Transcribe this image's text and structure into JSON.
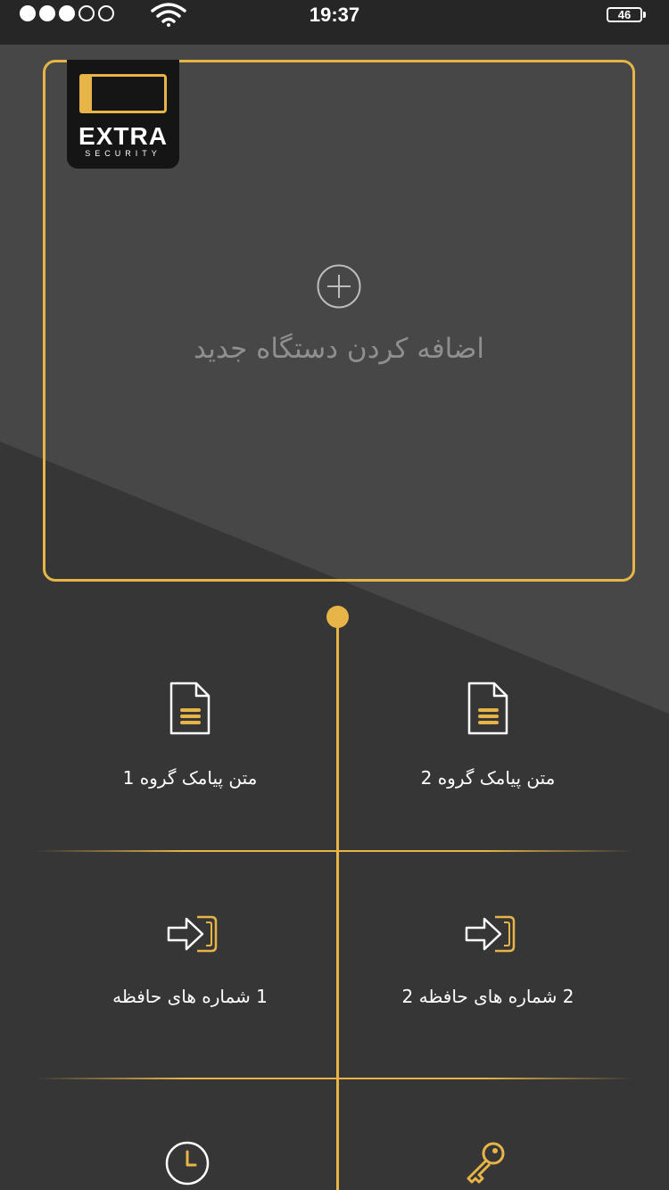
{
  "status_bar": {
    "time": "19:37",
    "battery": "46",
    "signal_dots": [
      true,
      true,
      true,
      false,
      false
    ]
  },
  "logo": {
    "brand": "EXTRA",
    "tagline": "SECURITY"
  },
  "device_card": {
    "add_label": "اضافه کردن دستگاه جدید"
  },
  "menu": [
    {
      "label": "متن پیامک گروه  1",
      "icon": "document-icon"
    },
    {
      "label": "متن پیامک گروه  2",
      "icon": "document-icon"
    },
    {
      "label": "1 شماره های حافظه",
      "icon": "sign-in-icon"
    },
    {
      "label": "2 شماره های حافظه 2",
      "icon": "sign-in-icon"
    },
    {
      "label": "",
      "icon": "clock-icon"
    },
    {
      "label": "",
      "icon": "key-icon"
    }
  ],
  "colors": {
    "accent": "#e7b547",
    "background": "#363636",
    "status_bar": "#262626"
  }
}
